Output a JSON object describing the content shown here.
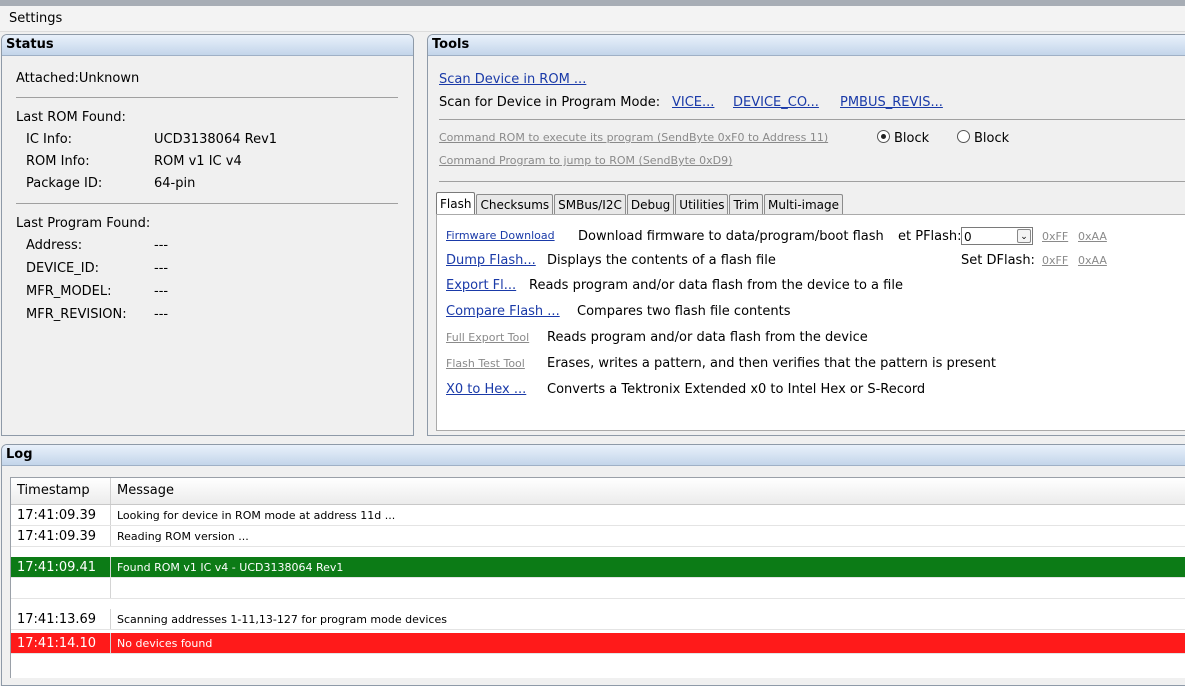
{
  "menu": {
    "settings": "Settings"
  },
  "status": {
    "header": "Status",
    "attached": "Attached:Unknown",
    "last_rom_title": "Last ROM Found:",
    "rom_rows": [
      {
        "label": "IC Info:",
        "value": "UCD3138064 Rev1"
      },
      {
        "label": "ROM Info:",
        "value": "ROM v1 IC v4"
      },
      {
        "label": "Package ID:",
        "value": "64-pin"
      }
    ],
    "last_program_title": "Last Program Found:",
    "program_rows": [
      {
        "label": "Address:",
        "value": "---"
      },
      {
        "label": "DEVICE_ID:",
        "value": "---"
      },
      {
        "label": "MFR_MODEL:",
        "value": "---"
      },
      {
        "label": "MFR_REVISION:",
        "value": "---"
      }
    ]
  },
  "tools": {
    "header": "Tools",
    "scan_rom": "Scan Device in ROM ...",
    "scan_program_label": "Scan for Device in Program Mode:",
    "scan_links": [
      "VICE...",
      "DEVICE_CO...",
      "PMBUS_REVIS..."
    ],
    "cmd_rom": "Command ROM to execute its program (SendByte 0xF0 to Address 11)",
    "radio_block_1": "Block",
    "radio_block_2": "Block",
    "cmd_program": "Command Program to jump to ROM (SendByte 0xD9)",
    "tabs": [
      "Flash",
      "Checksums",
      "SMBus/I2C",
      "Debug",
      "Utilities",
      "Trim",
      "Multi-image"
    ],
    "flash": {
      "firmware_download": "Firmware Download",
      "firmware_desc": "Download firmware to data/program/boot flash",
      "set_pflash": "et PFlash:",
      "pflash_value": "0",
      "hex_ff": "0xFF",
      "hex_aa": "0xAA",
      "set_dflash": "Set DFlash:",
      "hex_ff_2": "0xFF",
      "hex_aa_2": "0xAA",
      "items": [
        {
          "link": "Dump Flash...",
          "desc": "Displays the contents of a flash file",
          "disabled": false
        },
        {
          "link": "Export Fl...",
          "desc": "Reads program and/or data flash from the device to a file",
          "disabled": false
        },
        {
          "link": "Compare Flash ...",
          "desc": "Compares two flash file contents",
          "disabled": false
        },
        {
          "link": "Full Export Tool",
          "desc": "Reads program and/or data flash from the device",
          "disabled": true
        },
        {
          "link": "Flash Test Tool",
          "desc": "Erases, writes a pattern, and then verifies that the pattern is present",
          "disabled": true
        },
        {
          "link": "X0 to Hex ...",
          "desc": "Converts a Tektronix Extended x0 to Intel Hex or S-Record",
          "disabled": false
        }
      ]
    }
  },
  "log": {
    "header": "Log",
    "columns": [
      "Timestamp",
      "Message"
    ],
    "rows": [
      {
        "ts": "17:41:09.39",
        "msg": "Looking for device in ROM mode at address 11d ...",
        "style": "normal"
      },
      {
        "ts": "17:41:09.39",
        "msg": "Reading ROM version ...",
        "style": "normal"
      },
      {
        "ts": "17:41:09.41",
        "msg": "Found ROM v1 IC v4 - UCD3138064 Rev1",
        "style": "green"
      },
      {
        "ts": "",
        "msg": "",
        "style": "normal"
      },
      {
        "ts": "17:41:13.69",
        "msg": "Scanning addresses 1-11,13-127 for program mode devices",
        "style": "normal"
      },
      {
        "ts": "17:41:14.10",
        "msg": "No devices found",
        "style": "red"
      }
    ]
  }
}
